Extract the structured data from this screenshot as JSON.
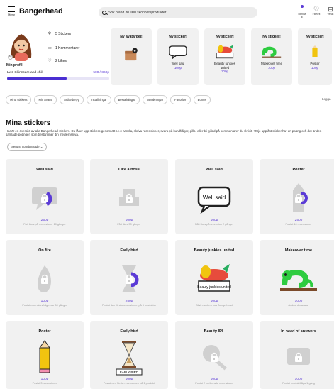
{
  "header": {
    "menu_label": "Meny",
    "logo": "Bangerhead",
    "search_placeholder": "Sök bland 30 000 skönhetsprodukter",
    "icons": [
      {
        "name": "avatar-icon",
        "label": "Denise E"
      },
      {
        "name": "heart-icon",
        "label": "Favorit"
      },
      {
        "name": "bag-icon",
        "label": "Varuk"
      }
    ]
  },
  "profile": {
    "name": "Min profil",
    "level": "Lv 3 Skinncare and chill",
    "points": "500 / 860p",
    "progress": 0.58,
    "stats": [
      {
        "icon": "sticker-icon",
        "label": "5 Stickers"
      },
      {
        "icon": "comment-icon",
        "label": "1 Kommentarer"
      },
      {
        "icon": "heart-icon",
        "label": "2 Likes"
      }
    ]
  },
  "featured": [
    {
      "title": "Ny avatardel!",
      "lines": [],
      "points": ""
    },
    {
      "title": "Ny sticker!",
      "lines": [
        "Well said"
      ],
      "points": "100p"
    },
    {
      "title": "Ny sticker!",
      "lines": [
        "Beauty junkies",
        "united"
      ],
      "points": "100p"
    },
    {
      "title": "Ny sticker!",
      "lines": [
        "Makeover time"
      ],
      "points": "100p"
    },
    {
      "title": "Ny sticker!",
      "lines": [
        "Poster"
      ],
      "points": "100p"
    }
  ],
  "tabs": [
    "Mina stickers",
    "Min Avatar",
    "Artikelbetyg",
    "Inställningar",
    "Beställningar",
    "Bevakningar",
    "Favoriter",
    "Bonus"
  ],
  "logout": "Logga",
  "section": {
    "title": "Mina stickers",
    "description": "Här är en översikt av alla Bangerhead-stickers. Du låser upp stickers genom att t.e.x handla, skriva recensioner, svara på kundfrågor, gilla- eller bli gillad på kommentarer du skrivit. Varje upplåst sticker har en poäng och det är den samlade poängen som bestämmer din medlemsnivå.",
    "sort": "Senast uppdaterade"
  },
  "cards": [
    {
      "title": "Well said",
      "points": "250p",
      "desc": "Fått likes på recensioner 10 gånger"
    },
    {
      "title": "Like a boss",
      "points": "100p",
      "desc": "Fått likes 50 gånger"
    },
    {
      "title": "Well said",
      "points": "100p",
      "desc": "Fått likes på recension 2 gånger",
      "art_text": "Well said"
    },
    {
      "title": "Poster",
      "points": "250p",
      "desc": "Postat 10 recensioner"
    },
    {
      "title": "On fire",
      "points": "100p",
      "desc": "Postat recension/frågesvar 50 gånger"
    },
    {
      "title": "Early bird",
      "points": "250p",
      "desc": "Postat den första recensionen på 5 produkter"
    },
    {
      "title": "Beauty junkies united",
      "points": "100p",
      "desc": "Blivit medlem hos Bangerhead",
      "art_text": "Beauty junkies united"
    },
    {
      "title": "Makeover time",
      "points": "100p",
      "desc": "Ändrat din avatar"
    },
    {
      "title": "Poster",
      "points": "100p",
      "desc": "Postat 3 recensioner"
    },
    {
      "title": "Early bird",
      "points": "100p",
      "desc": "Postat den första recensionen på 1 produkt",
      "art_text": "EARLY BIRD"
    },
    {
      "title": "Beauty IRL",
      "points": "100p",
      "desc": "Postat 2 verifierade recensioner"
    },
    {
      "title": "In need of answers",
      "points": "100p",
      "desc": "Postat produktfråga 1 gång"
    }
  ],
  "colors": {
    "accent": "#5b3bd6",
    "card_bg": "#f1f1f1"
  }
}
